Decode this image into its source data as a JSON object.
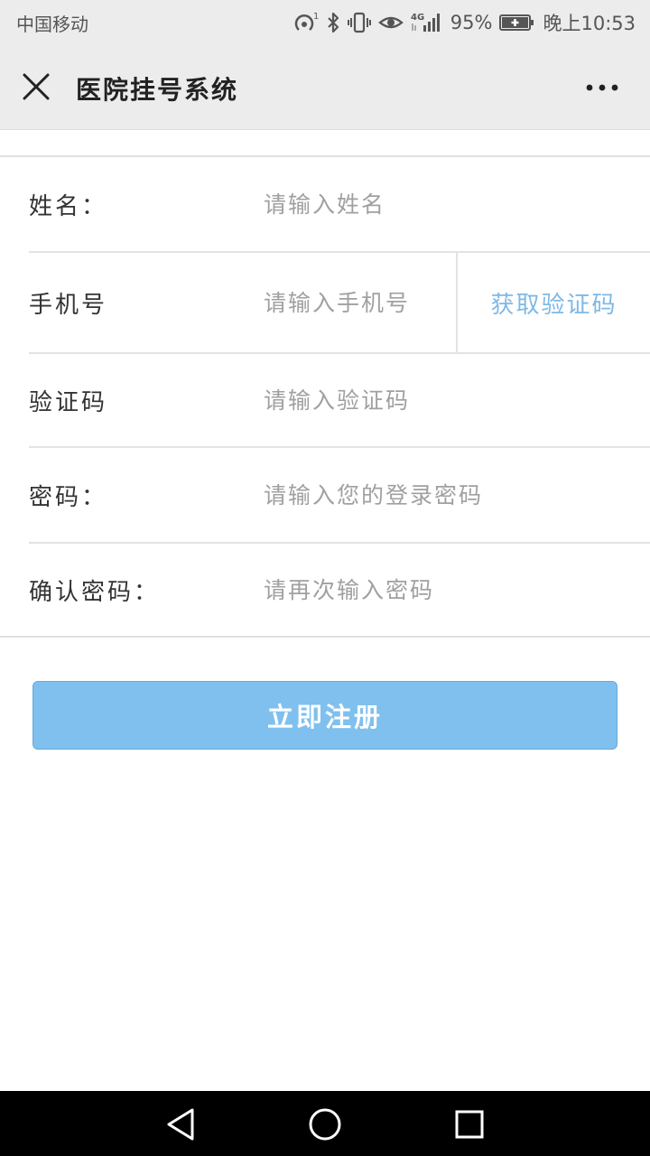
{
  "status_bar": {
    "carrier": "中国移动",
    "network": "4G",
    "battery": "95%",
    "time": "晚上10:53",
    "icons": [
      "hotspot-icon",
      "bluetooth-icon",
      "vibrate-icon",
      "eye-icon",
      "signal-icon",
      "battery-icon"
    ]
  },
  "header": {
    "title": "医院挂号系统",
    "close_icon": "close-icon",
    "more_icon": "more-icon"
  },
  "form": {
    "name": {
      "label": "姓名：",
      "placeholder": "请输入姓名",
      "value": ""
    },
    "phone": {
      "label": "手机号",
      "placeholder": "请输入手机号",
      "value": "",
      "get_code_label": "获取验证码"
    },
    "code": {
      "label": "验证码",
      "placeholder": "请输入验证码",
      "value": ""
    },
    "password": {
      "label": "密码：",
      "placeholder": "请输入您的登录密码",
      "value": ""
    },
    "confirm": {
      "label": "确认密码：",
      "placeholder": "请再次输入密码",
      "value": ""
    }
  },
  "register_button": {
    "label": "立即注册"
  },
  "nav_bar": {
    "icons": [
      "back-icon",
      "home-icon",
      "recents-icon"
    ]
  },
  "colors": {
    "accent": "#7fc0ef",
    "link": "#7fb9e6",
    "header_bg": "#ececec",
    "nav_bg": "#000000"
  }
}
